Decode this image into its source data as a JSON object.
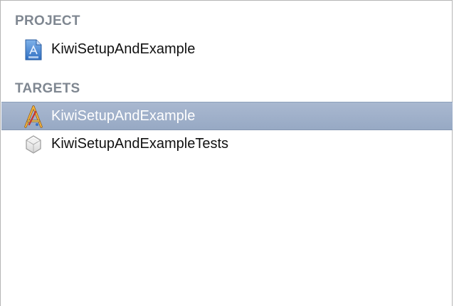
{
  "sections": {
    "project": {
      "header": "PROJECT",
      "items": [
        {
          "label": "KiwiSetupAndExample",
          "icon": "xcode-project-file-icon"
        }
      ]
    },
    "targets": {
      "header": "TARGETS",
      "items": [
        {
          "label": "KiwiSetupAndExample",
          "icon": "app-target-icon",
          "selected": true
        },
        {
          "label": "KiwiSetupAndExampleTests",
          "icon": "test-bundle-icon",
          "selected": false
        }
      ]
    }
  },
  "colors": {
    "header_text": "#7f8791",
    "selection": "#9fb0ca",
    "border": "#b5b5b5"
  }
}
